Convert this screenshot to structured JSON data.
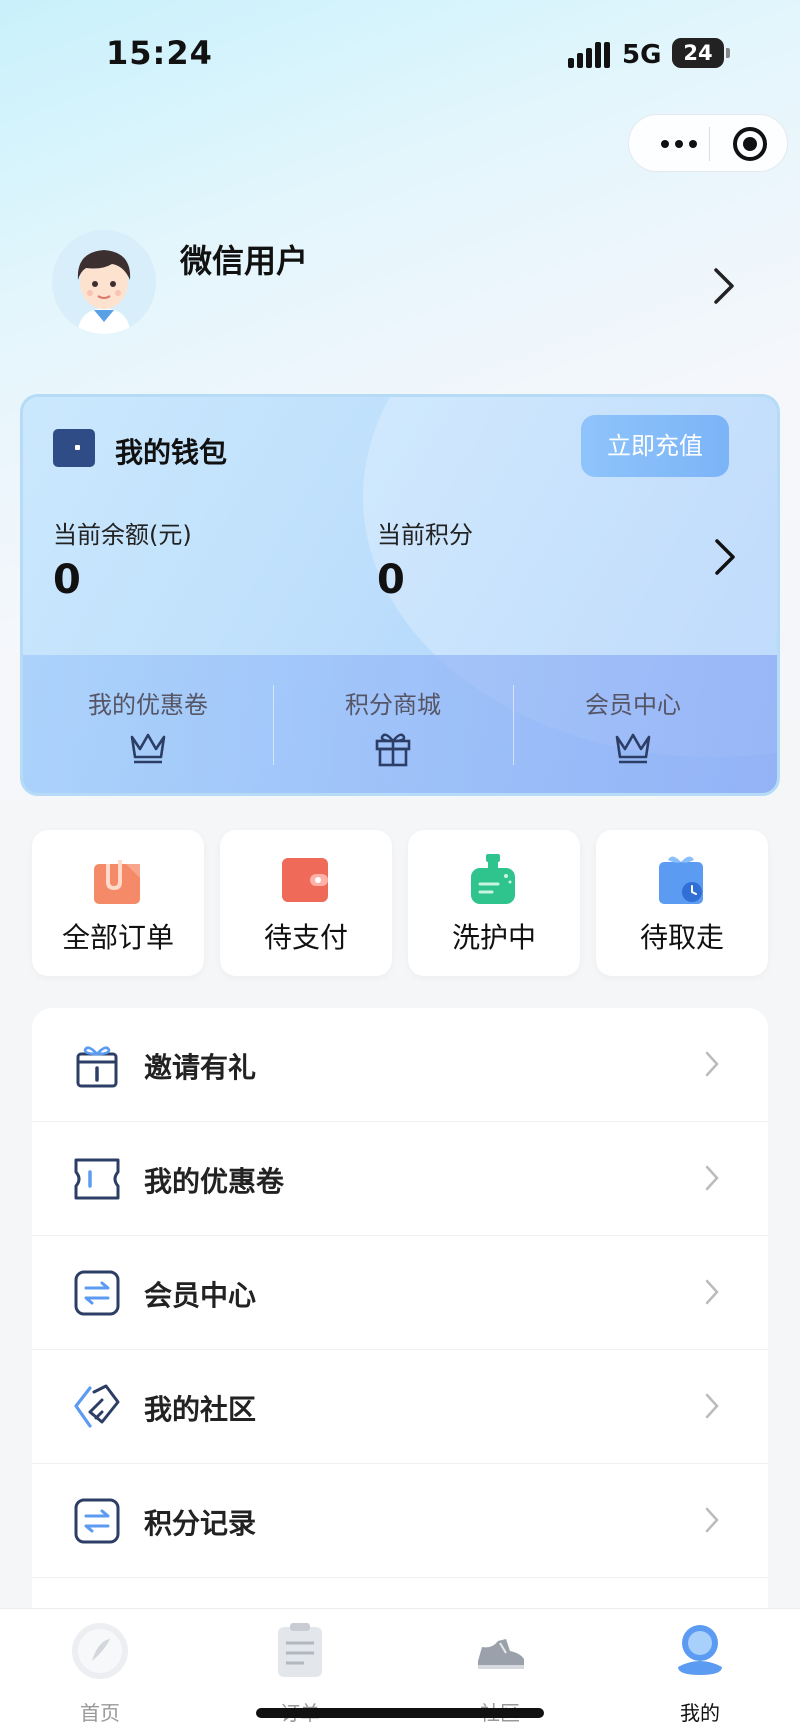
{
  "status_bar": {
    "time": "15:24",
    "network": "5G",
    "battery": "24"
  },
  "capsule": {
    "more_icon": "more-dots-icon",
    "close_icon": "target-close-icon"
  },
  "profile": {
    "nickname": "微信用户",
    "avatar_icon": "boy-avatar"
  },
  "wallet": {
    "title": "我的钱包",
    "recharge_label": "立即充值",
    "balance_label": "当前余额(元)",
    "balance_value": "0",
    "points_label": "当前积分",
    "points_value": "0",
    "shortcuts": [
      {
        "label": "我的优惠卷",
        "icon": "crown-icon"
      },
      {
        "label": "积分商城",
        "icon": "gift-icon"
      },
      {
        "label": "会员中心",
        "icon": "crown-icon"
      }
    ]
  },
  "orders": [
    {
      "label": "全部订单",
      "icon": "bag-icon",
      "color": "#f58a68"
    },
    {
      "label": "待支付",
      "icon": "wallet-icon",
      "color": "#f06a5a"
    },
    {
      "label": "洗护中",
      "icon": "soap-bottle-icon",
      "color": "#2fc48d"
    },
    {
      "label": "待取走",
      "icon": "gift-box-clock-icon",
      "color": "#5b9bf2"
    }
  ],
  "menu": [
    {
      "label": "邀请有礼",
      "icon": "gift-icon"
    },
    {
      "label": "我的优惠卷",
      "icon": "ticket-icon"
    },
    {
      "label": "会员中心",
      "icon": "exchange-icon"
    },
    {
      "label": "我的社区",
      "icon": "handshake-icon"
    },
    {
      "label": "积分记录",
      "icon": "exchange-icon"
    }
  ],
  "tabbar": [
    {
      "label": "首页",
      "icon": "home-icon"
    },
    {
      "label": "订单",
      "icon": "order-icon"
    },
    {
      "label": "社区",
      "icon": "sneaker-icon"
    },
    {
      "label": "我的",
      "icon": "profile-icon"
    }
  ],
  "colors": {
    "accent": "#7bb4f7",
    "wallet_bg": "#bfe0fc",
    "page_bg": "#f5f6f8"
  }
}
